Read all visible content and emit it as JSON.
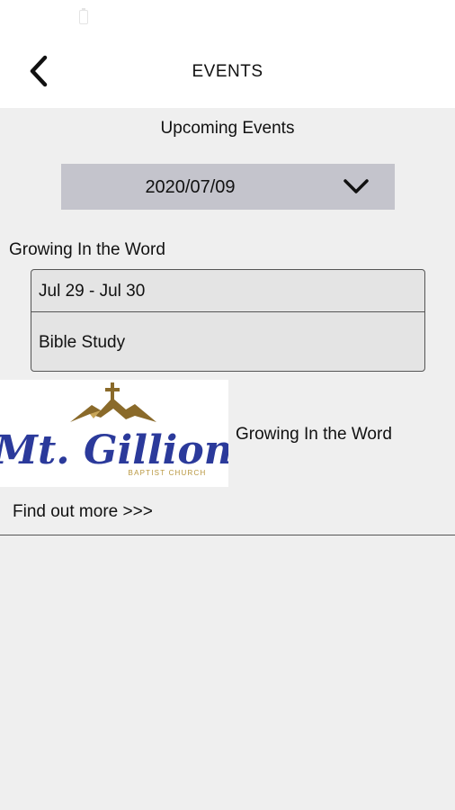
{
  "header": {
    "title": "EVENTS",
    "back_icon": "chevron-left-icon"
  },
  "main": {
    "section_title": "Upcoming Events",
    "date_select": {
      "value": "2020/07/09",
      "icon": "chevron-down-icon"
    },
    "event": {
      "heading": "Growing In the Word",
      "dates": "Jul 29 - Jul 30",
      "name": "Bible Study"
    },
    "promo": {
      "logo": {
        "main_text": "Mt. Gillion",
        "sub_text": "BAPTIST CHURCH",
        "colors": {
          "script": "#2b3a9b",
          "mountain": "#8a6a2a",
          "sub_text": "#b8963e"
        }
      },
      "title": "Growing In the Word",
      "link": "Find out more >>>"
    }
  },
  "colors": {
    "background": "#efefef",
    "header_background": "#ffffff",
    "select_background": "#c4c4cc",
    "card_background": "#e4e4e4",
    "border": "#555555"
  }
}
